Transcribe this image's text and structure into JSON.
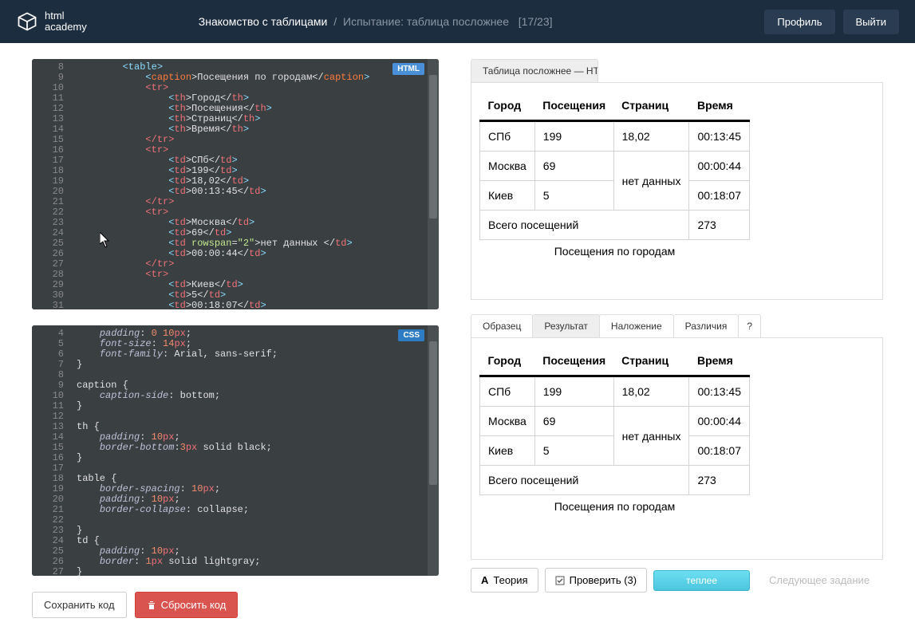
{
  "header": {
    "logo_top": "html",
    "logo_bottom": "academy",
    "breadcrumb_first": "Знакомство с таблицами",
    "breadcrumb_sep": "/",
    "breadcrumb_second": "Испытание: таблица посложнее",
    "breadcrumb_progress": "[17/23]",
    "profile": "Профиль",
    "logout": "Выйти"
  },
  "editor": {
    "html_badge": "HTML",
    "css_badge": "CSS",
    "html_lines_start": 8,
    "html_lines_end": 31,
    "css_lines_start": 4,
    "css_lines_end": 27
  },
  "html_code": {
    "l8": "        <table>",
    "l9a": "            <",
    "l9b": "caption",
    "l9c": ">Посещения по городам</",
    "l9d": "caption",
    "l9e": ">",
    "l10": "            <tr>",
    "l11a": "                <",
    "l11b": "th",
    "l11c": ">Город</",
    "l11d": "th",
    "l11e": ">",
    "l12a": "                <",
    "l12b": "th",
    "l12c": ">Посещения</",
    "l12d": "th",
    "l12e": ">",
    "l13a": "                <",
    "l13b": "th",
    "l13c": ">Страниц</",
    "l13d": "th",
    "l13e": ">",
    "l14a": "                <",
    "l14b": "th",
    "l14c": ">Время</",
    "l14d": "th",
    "l14e": ">",
    "l15": "            </tr>",
    "l16": "            <tr>",
    "l17a": "                <",
    "l17b": "td",
    "l17c": ">СПб</",
    "l17d": "td",
    "l17e": ">",
    "l18a": "                <",
    "l18b": "td",
    "l18c": ">199</",
    "l18d": "td",
    "l18e": ">",
    "l19a": "                <",
    "l19b": "td",
    "l19c": ">18,02</",
    "l19d": "td",
    "l19e": ">",
    "l20a": "                <",
    "l20b": "td",
    "l20c": ">00:13:45</",
    "l20d": "td",
    "l20e": ">",
    "l21": "            </tr>",
    "l22": "            <tr>",
    "l23a": "                <",
    "l23b": "td",
    "l23c": ">Москва</",
    "l23d": "td",
    "l23e": ">",
    "l24a": "                <",
    "l24b": "td",
    "l24c": ">69</",
    "l24d": "td",
    "l24e": ">",
    "l25a": "                <",
    "l25b": "td ",
    "l25attr": "rowspan",
    "l25eq": "=",
    "l25val": "\"2\"",
    "l25c": ">нет данных </",
    "l25d": "td",
    "l25e": ">",
    "l26a": "                <",
    "l26b": "td",
    "l26c": ">00:00:44</",
    "l26d": "td",
    "l26e": ">",
    "l27": "            </tr>",
    "l28": "            <tr>",
    "l29a": "                <",
    "l29b": "td",
    "l29c": ">Киев</",
    "l29d": "td",
    "l29e": ">",
    "l30a": "                <",
    "l30b": "td",
    "l30c": ">5</",
    "l30d": "td",
    "l30e": ">",
    "l31a": "                <",
    "l31b": "td",
    "l31c": ">00:18:07</",
    "l31d": "td",
    "l31e": ">"
  },
  "css_code": {
    "l4a": "    ",
    "l4b": "padding",
    "l4c": ": ",
    "l4d": "0 10",
    "l4e": "px",
    "l4f": ";",
    "l5a": "    ",
    "l5b": "font-size",
    "l5c": ": ",
    "l5d": "14",
    "l5e": "px",
    "l5f": ";",
    "l6a": "    ",
    "l6b": "font-family",
    "l6c": ": Arial, sans-serif;",
    "l7": "}",
    "l8": "",
    "l9": "caption {",
    "l10a": "    ",
    "l10b": "caption-side",
    "l10c": ": bottom;",
    "l11": "}",
    "l12": "",
    "l13": "th {",
    "l14a": "    ",
    "l14b": "padding",
    "l14c": ": ",
    "l14d": "10",
    "l14e": "px",
    "l14f": ";",
    "l15a": "    ",
    "l15b": "border-bottom",
    "l15c": ":",
    "l15d": "3",
    "l15e": "px",
    "l15f": " solid black;",
    "l16": "}",
    "l17": "",
    "l18": "table {",
    "l19a": "    ",
    "l19b": "border-spacing",
    "l19c": ": ",
    "l19d": "10",
    "l19e": "px",
    "l19f": ";",
    "l20a": "    ",
    "l20b": "padding",
    "l20c": ": ",
    "l20d": "10",
    "l20e": "px",
    "l20f": ";",
    "l21a": "    ",
    "l21b": "border-collapse",
    "l21c": ": collapse;",
    "l22": "",
    "l23": "}",
    "l24": "td {",
    "l25a": "    ",
    "l25b": "padding",
    "l25c": ": ",
    "l25d": "10",
    "l25e": "px",
    "l25f": ";",
    "l26a": "    ",
    "l26b": "border",
    "l26c": ": ",
    "l26d": "1",
    "l26e": "px",
    "l26f": " solid lightgray;",
    "l27": "}"
  },
  "preview": {
    "tab_title": "Таблица посложнее — HTML Aca",
    "caption": "Посещения по городам",
    "headers": [
      "Город",
      "Посещения",
      "Страниц",
      "Время"
    ],
    "rows": [
      [
        "СПб",
        "199",
        "18,02",
        "00:13:45"
      ],
      [
        "Москва",
        "69",
        null,
        "00:00:44"
      ],
      [
        "Киев",
        "5",
        null,
        "00:18:07"
      ]
    ],
    "no_data": "нет данных",
    "footer_label": "Всего посещений",
    "footer_value": "273"
  },
  "compare_tabs": {
    "sample": "Образец",
    "result": "Результат",
    "overlay": "Наложение",
    "diff": "Различия",
    "help": "?"
  },
  "buttons": {
    "save": "Сохранить код",
    "reset": "Сбросить код",
    "theory": "Теория",
    "check": "Проверить (3)",
    "heat": "теплее",
    "next": "Следующее задание"
  }
}
